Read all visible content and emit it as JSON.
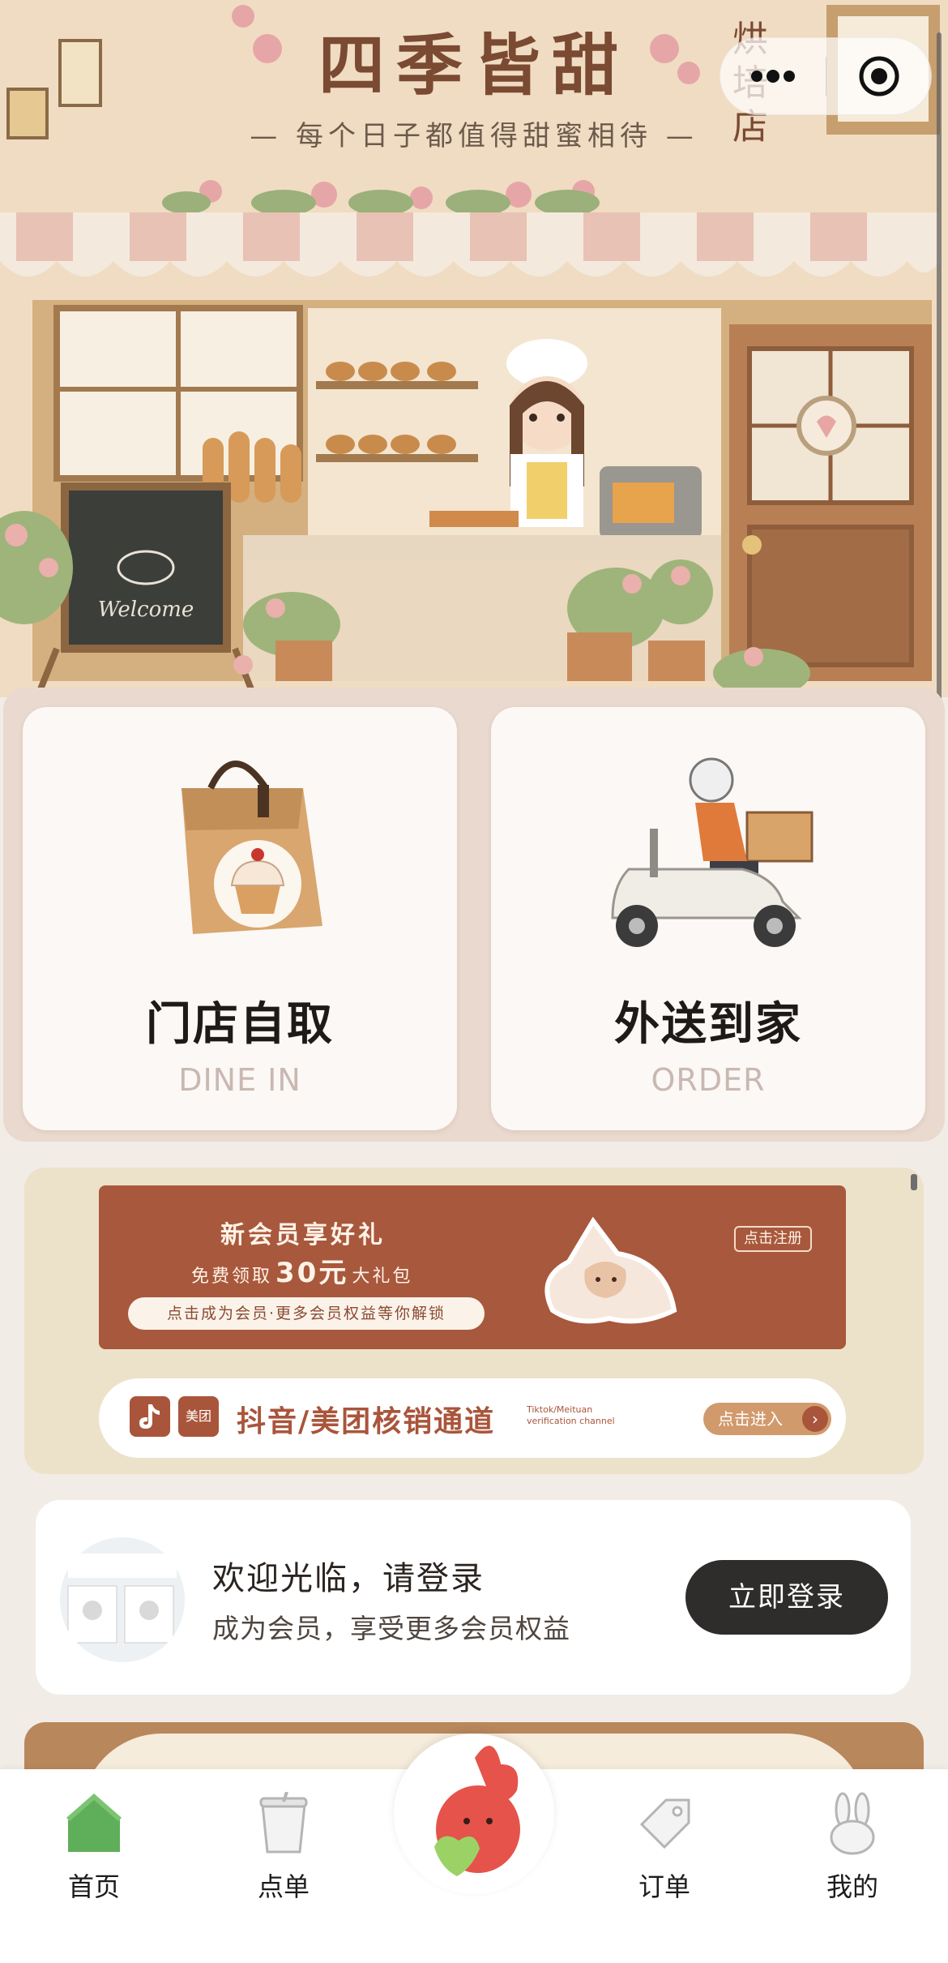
{
  "hero": {
    "title": "四季皆甜",
    "subtitle": "— 每个日子都值得甜蜜相待 —",
    "side_text": "烘\n培\n店",
    "chalkboard_text": "Welcome"
  },
  "capsule": {
    "more_icon": "more-dots-icon",
    "close_icon": "target-circle-icon"
  },
  "services": [
    {
      "title": "门店自取",
      "subtitle": "DINE IN",
      "icon": "paper-bag-cupcake-icon"
    },
    {
      "title": "外送到家",
      "subtitle": "ORDER",
      "icon": "delivery-scooter-icon"
    }
  ],
  "member_banner": {
    "title": "新会员享好礼",
    "line_prefix": "免费领取",
    "amount": "30元",
    "line_suffix": "大礼包",
    "pill": "点击成为会员·更多会员权益等你解锁",
    "register": "点击注册"
  },
  "verify_bar": {
    "meituan_label": "美团",
    "text": "抖音/美团核销通道",
    "english": "Tiktok/Meituan verification channel",
    "enter": "点击进入"
  },
  "login": {
    "title": "欢迎光临，请登录",
    "description": "成为会员，享受更多会员权益",
    "button": "立即登录"
  },
  "tabbar": {
    "items": [
      {
        "label": "首页",
        "icon": "home-icon",
        "active": true
      },
      {
        "label": "点单",
        "icon": "cup-icon",
        "active": false
      },
      {
        "label": "订单",
        "icon": "tag-icon",
        "active": false
      },
      {
        "label": "我的",
        "icon": "rabbit-icon",
        "active": false
      }
    ],
    "center_icon": "bunny-mascot-icon"
  },
  "colors": {
    "accent_brown": "#a9553b",
    "dark_button": "#2f2d2c",
    "home_active": "#5fae5a"
  }
}
